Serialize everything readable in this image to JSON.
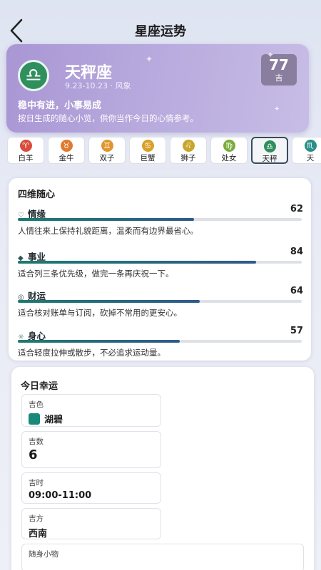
{
  "header": {
    "title": "星座运势"
  },
  "hero": {
    "symbol": "♎",
    "name": "天秤座",
    "subtitle": "9.23-10.23 · 风象",
    "score": "77",
    "level": "吉",
    "headline": "稳中有进，小事易成",
    "description": "按日生成的随心小览，供你当作今日的心情参考。"
  },
  "signs": [
    {
      "symbol": "♈",
      "label": "白羊",
      "color": "#d94b3b"
    },
    {
      "symbol": "♉",
      "label": "金牛",
      "color": "#e07a2e"
    },
    {
      "symbol": "♊",
      "label": "双子",
      "color": "#e0962a"
    },
    {
      "symbol": "♋",
      "label": "巨蟹",
      "color": "#d9a028"
    },
    {
      "symbol": "♌",
      "label": "狮子",
      "color": "#c9a52a"
    },
    {
      "symbol": "♍",
      "label": "处女",
      "color": "#7bab3a"
    },
    {
      "symbol": "♎",
      "label": "天秤",
      "color": "#2f8f5d",
      "active": true
    },
    {
      "symbol": "♏",
      "label": "天",
      "color": "#2a8f8a"
    }
  ],
  "dimensions": {
    "title": "四维随心",
    "items": [
      {
        "icon": "♡",
        "name": "情缘",
        "value": 62,
        "text": "人情往来上保持礼貌距离，温柔而有边界最省心。"
      },
      {
        "icon": "◆",
        "name": "事业",
        "value": 84,
        "text": "适合列三条优先级，做完一条再庆祝一下。"
      },
      {
        "icon": "◎",
        "name": "财运",
        "value": 64,
        "text": "适合核对账单与订阅，砍掉不常用的更安心。"
      },
      {
        "icon": "☼",
        "name": "身心",
        "value": 57,
        "text": "适合轻度拉伸或散步，不必追求运动量。"
      }
    ]
  },
  "lucky": {
    "title": "今日幸运",
    "color_label": "吉色",
    "color_value": "湖碧",
    "color_hex": "#17897a",
    "number_label": "吉数",
    "number_value": "6",
    "time_label": "吉时",
    "time_value": "09:00-11:00",
    "direction_label": "吉方",
    "direction_value": "西南",
    "item_label": "随身小物"
  }
}
